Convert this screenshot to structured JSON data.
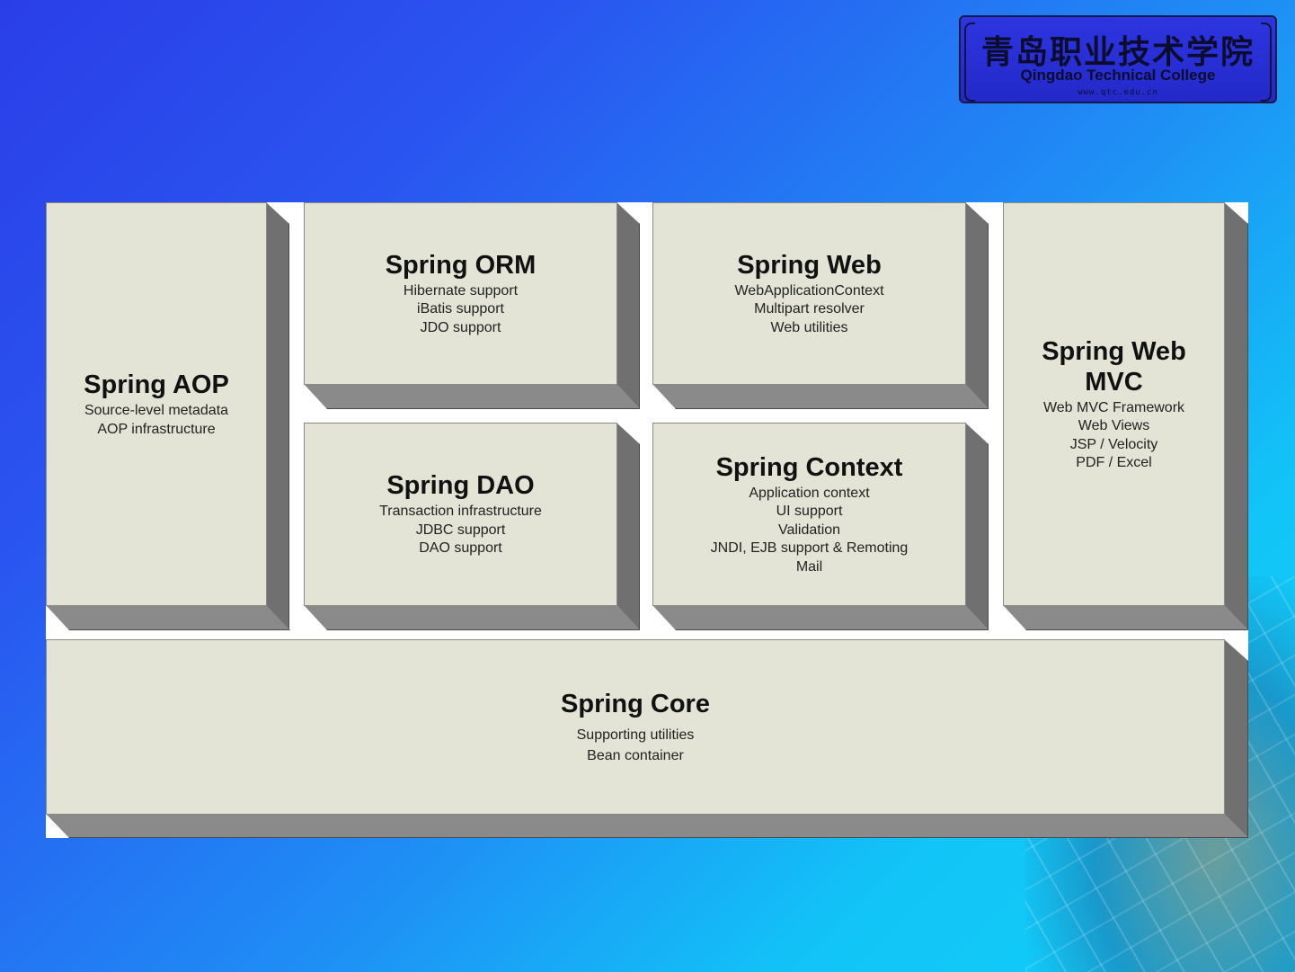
{
  "logo": {
    "chinese": "青岛职业技术学院",
    "english": "Qingdao Technical College",
    "sub": "www.qtc.edu.cn"
  },
  "modules": {
    "aop": {
      "title": "Spring AOP",
      "lines": [
        "Source-level metadata",
        "AOP infrastructure"
      ]
    },
    "orm": {
      "title": "Spring ORM",
      "lines": [
        "Hibernate support",
        "iBatis support",
        "JDO support"
      ]
    },
    "web": {
      "title": "Spring Web",
      "lines": [
        "WebApplicationContext",
        "Multipart resolver",
        "Web utilities"
      ]
    },
    "webmvc": {
      "title_1": "Spring Web",
      "title_2": "MVC",
      "lines": [
        "Web MVC Framework",
        "Web Views",
        "JSP / Velocity",
        "PDF / Excel"
      ]
    },
    "dao": {
      "title": "Spring DAO",
      "lines": [
        "Transaction infrastructure",
        "JDBC support",
        "DAO support"
      ]
    },
    "context": {
      "title": "Spring Context",
      "lines": [
        "Application context",
        "UI support",
        "Validation",
        "JNDI, EJB support & Remoting",
        "Mail"
      ]
    },
    "core": {
      "title": "Spring Core",
      "lines": [
        "Supporting utilities",
        "Bean container"
      ]
    }
  }
}
